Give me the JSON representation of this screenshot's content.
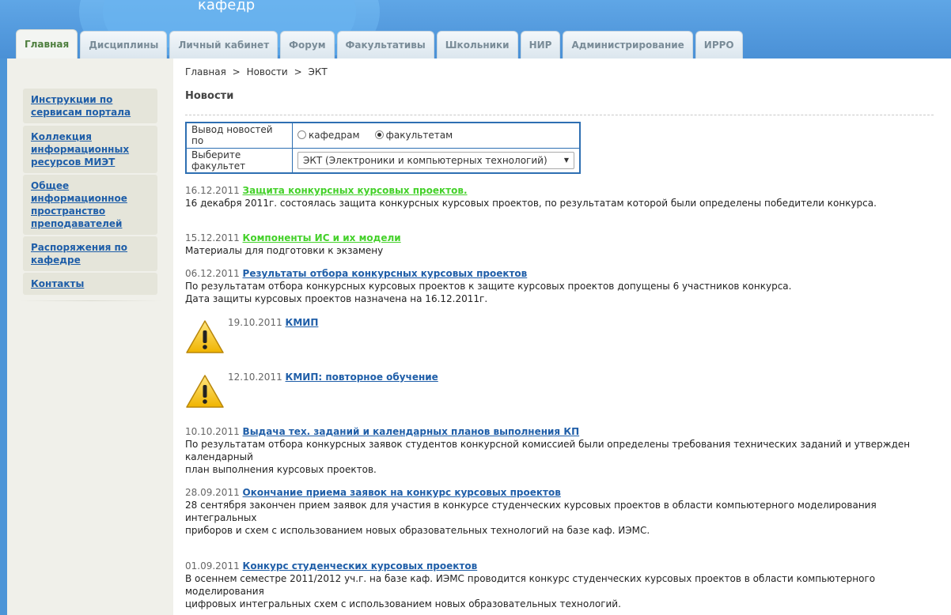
{
  "header": {
    "title": "кафедр"
  },
  "tabs": [
    {
      "label": "Главная"
    },
    {
      "label": "Дисциплины"
    },
    {
      "label": "Личный кабинет"
    },
    {
      "label": "Форум"
    },
    {
      "label": "Факультативы"
    },
    {
      "label": "Школьники"
    },
    {
      "label": "НИР"
    },
    {
      "label": "Администрирование"
    },
    {
      "label": "ИРРО"
    }
  ],
  "sidebar": {
    "items": [
      {
        "label": "Инструкции по сервисам портала"
      },
      {
        "label": "Коллекция информационных ресурсов МИЭТ"
      },
      {
        "label": "Общее информационное пространство преподавателей"
      },
      {
        "label": "Распоряжения по кафедре"
      },
      {
        "label": "Контакты"
      }
    ]
  },
  "breadcrumb": {
    "parts": [
      "Главная",
      ">",
      "Новости",
      ">",
      "ЭКТ"
    ]
  },
  "page_title": "Новости",
  "filter": {
    "row1_label": "Вывод новостей по",
    "radio1": "кафедрам",
    "radio2": "факультетам",
    "row2_label": "Выберите факультет",
    "select_value": "ЭКТ (Электроники и компьютерных технологий)"
  },
  "news": [
    {
      "date": "16.12.2011",
      "title": "Защита конкурсных курсовых проектов.",
      "desc": [
        "16 декабря 2011г. состоялась защита конкурсных курсовых проектов, по результатам которой были определены победители конкурса."
      ]
    },
    {
      "date": "15.12.2011",
      "title": "Компоненты ИС и их модели",
      "desc": [
        "Материалы для подготовки к экзамену"
      ]
    },
    {
      "date": "06.12.2011",
      "title": "Результаты отбора конкурсных курсовых проектов",
      "desc": [
        "По результатам отбора конкурсных курсовых проектов к защите курсовых проектов допущены 6 участников конкурса.",
        "Дата защиты курсовых проектов назначена на 16.12.2011г."
      ]
    },
    {
      "date": "19.10.2011",
      "title": "КМИП",
      "desc": []
    },
    {
      "date": "12.10.2011",
      "title": "КМИП: повторное обучение",
      "desc": []
    },
    {
      "date": "10.10.2011",
      "title": "Выдача тех. заданий и календарных планов выполнения КП",
      "desc": [
        "По результатам отбора конкурсных заявок студентов конкурсной комиссией были определены требования технических заданий и утвержден календарный",
        "план выполнения курсовых проектов."
      ]
    },
    {
      "date": "28.09.2011",
      "title": "Окончание приема заявок на конкурс курсовых проектов",
      "desc": [
        "28 сентября закончен прием заявок для участия в конкурсе студенческих курсовых проектов в области компьютерного моделирования интегральных",
        "приборов и схем с использованием новых образовательных технологий на базе каф. ИЭМС."
      ]
    },
    {
      "date": "01.09.2011",
      "title": "Конкурс студенческих курсовых проектов",
      "desc": [
        "В осеннем семестре 2011/2012 уч.г. на базе каф. ИЭМС проводится конкурс студенческих курсовых проектов в области компьютерного моделирования",
        "цифровых интегральных схем с использованием новых образовательных технологий."
      ]
    }
  ]
}
